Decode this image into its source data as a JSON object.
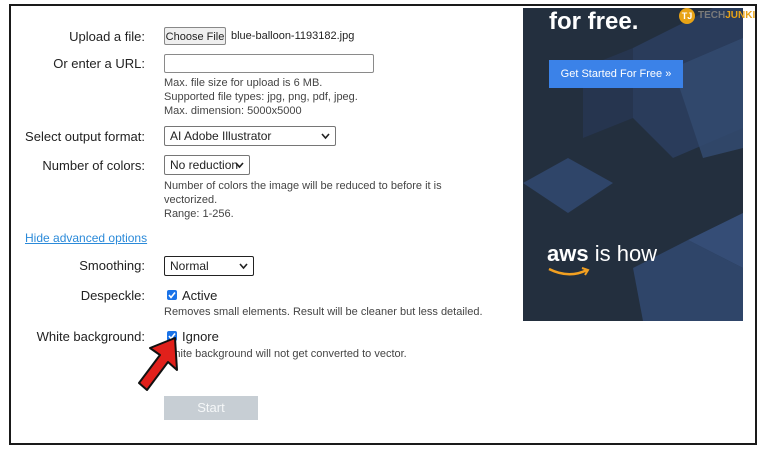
{
  "form": {
    "upload_label": "Upload a file:",
    "choose_file_label": "Choose File",
    "file_name": "blue-balloon-1193182.jpg",
    "url_label": "Or enter a URL:",
    "url_value": "",
    "upload_hint": [
      "Max. file size for upload is 6 MB.",
      "Supported file types: jpg, png, pdf, jpeg.",
      "Max. dimension: 5000x5000"
    ],
    "output_format_label": "Select output format:",
    "output_format_value": "AI Adobe Illustrator",
    "colors_label": "Number of colors:",
    "colors_value": "No reduction",
    "colors_hint": [
      "Number of colors the image will be reduced to before it is",
      "vectorized.",
      "Range: 1-256."
    ],
    "advanced_link": "Hide advanced options",
    "smoothing_label": "Smoothing:",
    "smoothing_value": "Normal",
    "despeckle_label": "Despeckle:",
    "despeckle_option": "Active",
    "despeckle_checked": true,
    "despeckle_hint": "Removes small elements. Result will be cleaner but less detailed.",
    "white_bg_label": "White background:",
    "white_bg_option": "Ignore",
    "white_bg_checked": true,
    "white_bg_hint": "White background will not get converted to vector.",
    "start_label": "Start"
  },
  "ad": {
    "headline": "for free.",
    "cta": "Get Started For Free »",
    "tagline_brand": "aws",
    "tagline_rest": " is how",
    "background": "#232f3e",
    "cta_color": "#3b82e8"
  },
  "watermark": {
    "initials": "TJ",
    "brand_part1": "TECH",
    "brand_part2": "JUNKIE"
  },
  "icons": [
    "chevron-down-icon",
    "checkmark-icon",
    "red-arrow-icon",
    "amazon-smile-icon"
  ]
}
